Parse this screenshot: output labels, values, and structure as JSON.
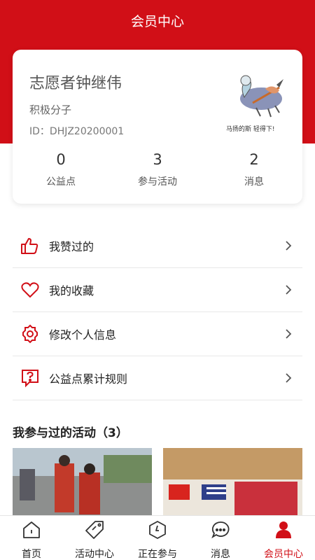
{
  "header": {
    "title": "会员中心"
  },
  "profile": {
    "name": "志愿者钟继伟",
    "badge": "积极分子",
    "member_id": "ID：DHJZ20200001",
    "avatar_caption": "马扬的斯  轻得下!"
  },
  "stats": [
    {
      "value": "0",
      "label": "公益点"
    },
    {
      "value": "3",
      "label": "参与活动"
    },
    {
      "value": "2",
      "label": "消息"
    }
  ],
  "menu": [
    {
      "label": "我赞过的",
      "icon": "thumbs-up-icon"
    },
    {
      "label": "我的收藏",
      "icon": "heart-icon"
    },
    {
      "label": "修改个人信息",
      "icon": "gear-icon"
    },
    {
      "label": "公益点累计规则",
      "icon": "question-bubble-icon"
    }
  ],
  "activities": {
    "title": "我参与过的活动（3）"
  },
  "tabbar": [
    {
      "label": "首页",
      "icon": "home-icon",
      "active": false
    },
    {
      "label": "活动中心",
      "icon": "tag-icon",
      "active": false
    },
    {
      "label": "正在参与",
      "icon": "clock-icon",
      "active": false
    },
    {
      "label": "消息",
      "icon": "chat-icon",
      "active": false
    },
    {
      "label": "会员中心",
      "icon": "user-icon",
      "active": true
    }
  ],
  "colors": {
    "accent": "#d10f17",
    "text": "#222222"
  }
}
